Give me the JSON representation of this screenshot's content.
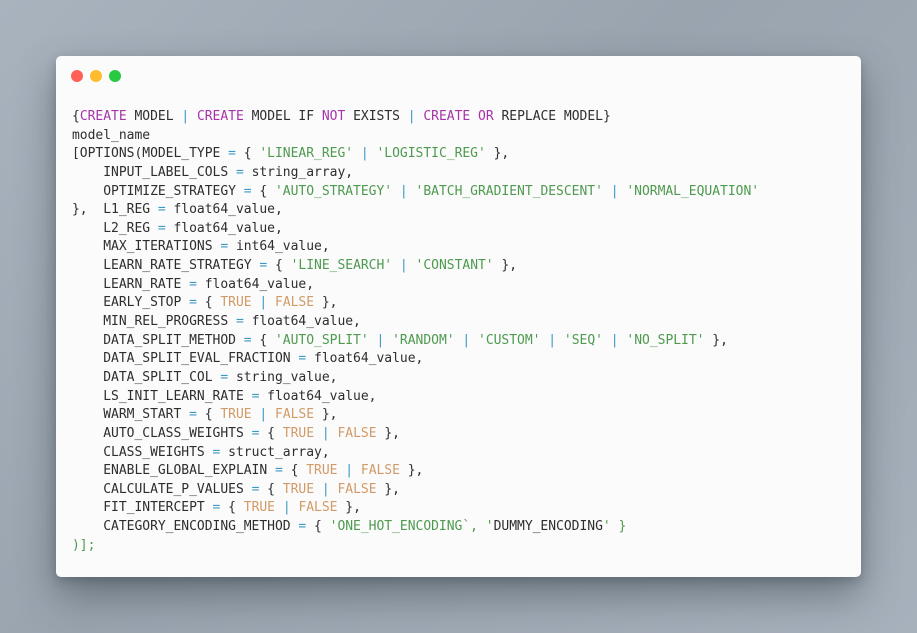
{
  "window": {
    "controls": [
      {
        "name": "close",
        "color": "#ff5f57"
      },
      {
        "name": "minimize",
        "color": "#febc2e"
      },
      {
        "name": "maximize",
        "color": "#28c840"
      }
    ]
  },
  "code": {
    "language": "sql",
    "lines": [
      [
        [
          "pl",
          "{"
        ],
        [
          "kw",
          "CREATE"
        ],
        [
          "pl",
          " MODEL "
        ],
        [
          "op",
          "|"
        ],
        [
          "pl",
          " "
        ],
        [
          "kw",
          "CREATE"
        ],
        [
          "pl",
          " MODEL IF "
        ],
        [
          "kw",
          "NOT"
        ],
        [
          "pl",
          " EXISTS "
        ],
        [
          "op",
          "|"
        ],
        [
          "pl",
          " "
        ],
        [
          "kw",
          "CREATE"
        ],
        [
          "pl",
          " "
        ],
        [
          "kw",
          "OR"
        ],
        [
          "pl",
          " REPLACE MODEL}"
        ]
      ],
      [
        [
          "pl",
          "model_name"
        ]
      ],
      [
        [
          "pl",
          "[OPTIONS(MODEL_TYPE "
        ],
        [
          "op",
          "="
        ],
        [
          "pl",
          " { "
        ],
        [
          "str",
          "'LINEAR_REG'"
        ],
        [
          "pl",
          " "
        ],
        [
          "op",
          "|"
        ],
        [
          "pl",
          " "
        ],
        [
          "str",
          "'LOGISTIC_REG'"
        ],
        [
          "pl",
          " },"
        ]
      ],
      [
        [
          "pl",
          "    INPUT_LABEL_COLS "
        ],
        [
          "op",
          "="
        ],
        [
          "pl",
          " string_array,"
        ]
      ],
      [
        [
          "pl",
          "    OPTIMIZE_STRATEGY "
        ],
        [
          "op",
          "="
        ],
        [
          "pl",
          " { "
        ],
        [
          "str",
          "'AUTO_STRATEGY'"
        ],
        [
          "pl",
          " "
        ],
        [
          "op",
          "|"
        ],
        [
          "pl",
          " "
        ],
        [
          "str",
          "'BATCH_GRADIENT_DESCENT'"
        ],
        [
          "pl",
          " "
        ],
        [
          "op",
          "|"
        ],
        [
          "pl",
          " "
        ],
        [
          "str",
          "'NORMAL_EQUATION'"
        ]
      ],
      [
        [
          "pl",
          "},  L1_REG "
        ],
        [
          "op",
          "="
        ],
        [
          "pl",
          " float64_value,"
        ]
      ],
      [
        [
          "pl",
          "    L2_REG "
        ],
        [
          "op",
          "="
        ],
        [
          "pl",
          " float64_value,"
        ]
      ],
      [
        [
          "pl",
          "    MAX_ITERATIONS "
        ],
        [
          "op",
          "="
        ],
        [
          "pl",
          " int64_value,"
        ]
      ],
      [
        [
          "pl",
          "    LEARN_RATE_STRATEGY "
        ],
        [
          "op",
          "="
        ],
        [
          "pl",
          " { "
        ],
        [
          "str",
          "'LINE_SEARCH'"
        ],
        [
          "pl",
          " "
        ],
        [
          "op",
          "|"
        ],
        [
          "pl",
          " "
        ],
        [
          "str",
          "'CONSTANT'"
        ],
        [
          "pl",
          " },"
        ]
      ],
      [
        [
          "pl",
          "    LEARN_RATE "
        ],
        [
          "op",
          "="
        ],
        [
          "pl",
          " float64_value,"
        ]
      ],
      [
        [
          "pl",
          "    EARLY_STOP "
        ],
        [
          "op",
          "="
        ],
        [
          "pl",
          " { "
        ],
        [
          "bool",
          "TRUE"
        ],
        [
          "pl",
          " "
        ],
        [
          "op",
          "|"
        ],
        [
          "pl",
          " "
        ],
        [
          "bool",
          "FALSE"
        ],
        [
          "pl",
          " },"
        ]
      ],
      [
        [
          "pl",
          "    MIN_REL_PROGRESS "
        ],
        [
          "op",
          "="
        ],
        [
          "pl",
          " float64_value,"
        ]
      ],
      [
        [
          "pl",
          "    DATA_SPLIT_METHOD "
        ],
        [
          "op",
          "="
        ],
        [
          "pl",
          " { "
        ],
        [
          "str",
          "'AUTO_SPLIT'"
        ],
        [
          "pl",
          " "
        ],
        [
          "op",
          "|"
        ],
        [
          "pl",
          " "
        ],
        [
          "str",
          "'RANDOM'"
        ],
        [
          "pl",
          " "
        ],
        [
          "op",
          "|"
        ],
        [
          "pl",
          " "
        ],
        [
          "str",
          "'CUSTOM'"
        ],
        [
          "pl",
          " "
        ],
        [
          "op",
          "|"
        ],
        [
          "pl",
          " "
        ],
        [
          "str",
          "'SEQ'"
        ],
        [
          "pl",
          " "
        ],
        [
          "op",
          "|"
        ],
        [
          "pl",
          " "
        ],
        [
          "str",
          "'NO_SPLIT'"
        ],
        [
          "pl",
          " },"
        ]
      ],
      [
        [
          "pl",
          "    DATA_SPLIT_EVAL_FRACTION "
        ],
        [
          "op",
          "="
        ],
        [
          "pl",
          " float64_value,"
        ]
      ],
      [
        [
          "pl",
          "    DATA_SPLIT_COL "
        ],
        [
          "op",
          "="
        ],
        [
          "pl",
          " string_value,"
        ]
      ],
      [
        [
          "pl",
          "    LS_INIT_LEARN_RATE "
        ],
        [
          "op",
          "="
        ],
        [
          "pl",
          " float64_value,"
        ]
      ],
      [
        [
          "pl",
          "    WARM_START "
        ],
        [
          "op",
          "="
        ],
        [
          "pl",
          " { "
        ],
        [
          "bool",
          "TRUE"
        ],
        [
          "pl",
          " "
        ],
        [
          "op",
          "|"
        ],
        [
          "pl",
          " "
        ],
        [
          "bool",
          "FALSE"
        ],
        [
          "pl",
          " },"
        ]
      ],
      [
        [
          "pl",
          "    AUTO_CLASS_WEIGHTS "
        ],
        [
          "op",
          "="
        ],
        [
          "pl",
          " { "
        ],
        [
          "bool",
          "TRUE"
        ],
        [
          "pl",
          " "
        ],
        [
          "op",
          "|"
        ],
        [
          "pl",
          " "
        ],
        [
          "bool",
          "FALSE"
        ],
        [
          "pl",
          " },"
        ]
      ],
      [
        [
          "pl",
          "    CLASS_WEIGHTS "
        ],
        [
          "op",
          "="
        ],
        [
          "pl",
          " struct_array,"
        ]
      ],
      [
        [
          "pl",
          "    ENABLE_GLOBAL_EXPLAIN "
        ],
        [
          "op",
          "="
        ],
        [
          "pl",
          " { "
        ],
        [
          "bool",
          "TRUE"
        ],
        [
          "pl",
          " "
        ],
        [
          "op",
          "|"
        ],
        [
          "pl",
          " "
        ],
        [
          "bool",
          "FALSE"
        ],
        [
          "pl",
          " },"
        ]
      ],
      [
        [
          "pl",
          "    CALCULATE_P_VALUES "
        ],
        [
          "op",
          "="
        ],
        [
          "pl",
          " { "
        ],
        [
          "bool",
          "TRUE"
        ],
        [
          "pl",
          " "
        ],
        [
          "op",
          "|"
        ],
        [
          "pl",
          " "
        ],
        [
          "bool",
          "FALSE"
        ],
        [
          "pl",
          " },"
        ]
      ],
      [
        [
          "pl",
          "    FIT_INTERCEPT "
        ],
        [
          "op",
          "="
        ],
        [
          "pl",
          " { "
        ],
        [
          "bool",
          "TRUE"
        ],
        [
          "pl",
          " "
        ],
        [
          "op",
          "|"
        ],
        [
          "pl",
          " "
        ],
        [
          "bool",
          "FALSE"
        ],
        [
          "pl",
          " },"
        ]
      ],
      [
        [
          "pl",
          "    CATEGORY_ENCODING_METHOD "
        ],
        [
          "op",
          "="
        ],
        [
          "pl",
          " { "
        ],
        [
          "str",
          "'ONE_HOT_ENCODING`, '"
        ],
        [
          "pl",
          "DUMMY_ENCODING"
        ],
        [
          "str",
          "' }"
        ]
      ],
      [
        [
          "str",
          ")];"
        ]
      ]
    ]
  }
}
